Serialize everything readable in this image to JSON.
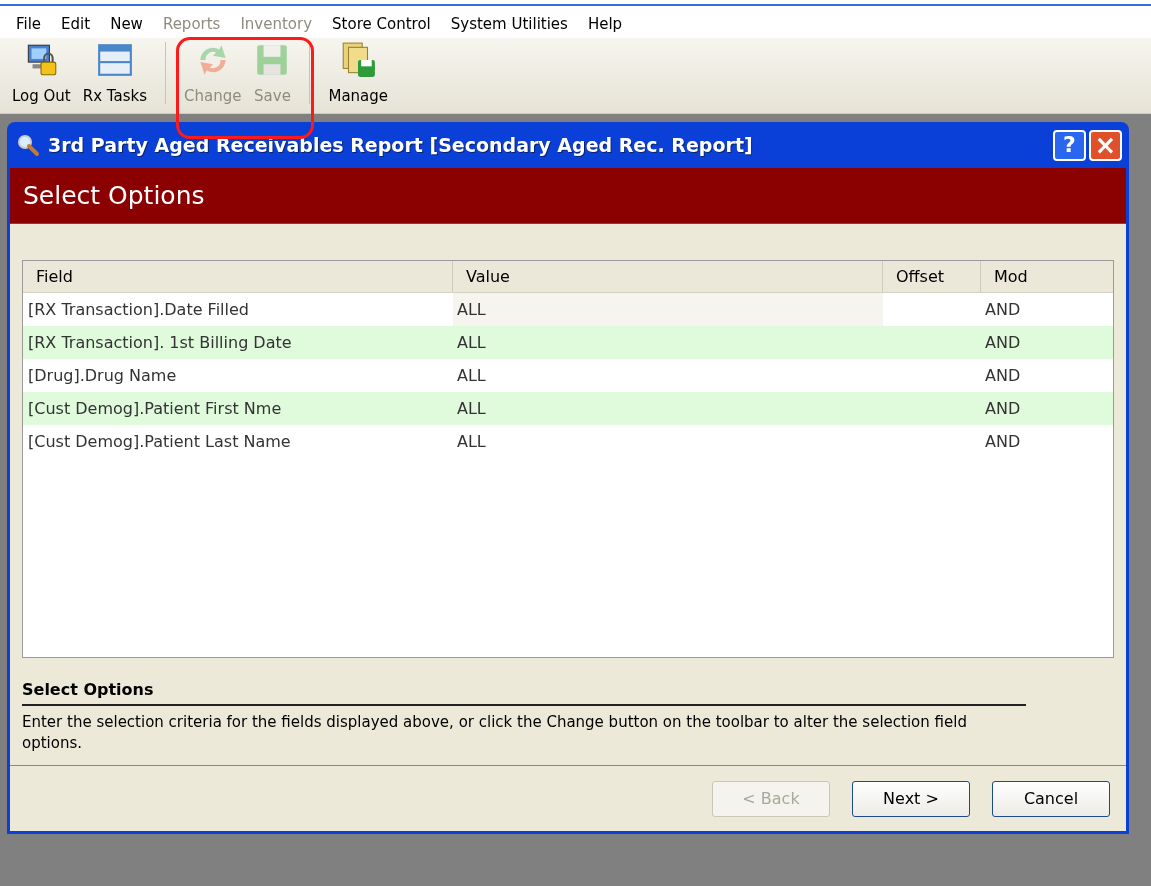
{
  "menu": [
    {
      "label": "File",
      "disabled": false
    },
    {
      "label": "Edit",
      "disabled": false
    },
    {
      "label": "New",
      "disabled": false
    },
    {
      "label": "Reports",
      "disabled": true
    },
    {
      "label": "Inventory",
      "disabled": true
    },
    {
      "label": "Store Control",
      "disabled": false
    },
    {
      "label": "System Utilities",
      "disabled": false
    },
    {
      "label": "Help",
      "disabled": false
    }
  ],
  "toolbar": [
    {
      "label": "Log Out",
      "kind": "logout",
      "disabled": false
    },
    {
      "label": "Rx Tasks",
      "kind": "tasks",
      "disabled": false
    },
    {
      "label": "Change",
      "kind": "change",
      "disabled": true
    },
    {
      "label": "Save",
      "kind": "save",
      "disabled": true
    },
    {
      "label": "Manage",
      "kind": "manage",
      "disabled": false
    }
  ],
  "dialog": {
    "title": "3rd Party Aged Receivables Report [Secondary Aged Rec. Report]",
    "help_button": "?",
    "close_button": "×",
    "header": "Select Options",
    "table": {
      "columns": [
        "Field",
        "Value",
        "Offset",
        "Mod"
      ],
      "rows": [
        [
          "[RX Transaction].Date Filled",
          "ALL",
          "",
          "AND"
        ],
        [
          "[RX Transaction]. 1st Billing Date",
          "ALL",
          "",
          "AND"
        ],
        [
          "[Drug].Drug Name",
          "ALL",
          "",
          "AND"
        ],
        [
          "[Cust Demog].Patient First Nme",
          "ALL",
          "",
          "AND"
        ],
        [
          "[Cust Demog].Patient Last Name",
          "ALL",
          "",
          "AND"
        ]
      ]
    },
    "description": {
      "title": "Select Options",
      "text": "Enter the selection criteria for the fields displayed above, or click the Change button on the toolbar to alter the selection field options."
    },
    "buttons": [
      {
        "label": "< Back",
        "disabled": true
      },
      {
        "label": "Next >",
        "disabled": false
      },
      {
        "label": "Cancel",
        "disabled": false
      }
    ]
  }
}
